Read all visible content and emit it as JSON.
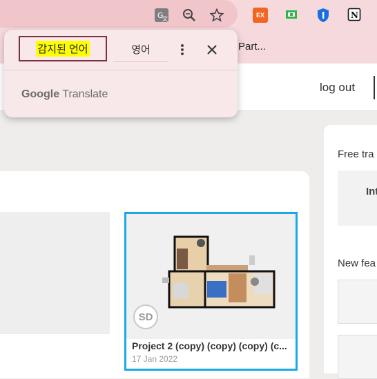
{
  "bookmarks": {
    "item_text": "Part..."
  },
  "header": {
    "logout_label": "log out"
  },
  "translate_popup": {
    "tab_detected": "감지된 언어",
    "tab_target": "영어",
    "brand_google": "Google",
    "brand_translate": "Translate"
  },
  "project": {
    "title": "Project 2 (copy) (copy) (copy) (c...",
    "date": "17 Jan 2022",
    "avatar_initials": "SD"
  },
  "sidebar": {
    "section_title": "Free tra",
    "box_label": "Int",
    "news_title": "New fea"
  },
  "extensions": {
    "ex_label": "EX"
  },
  "colors": {
    "accent": "#1aa8e6",
    "highlight": "#ffff00",
    "tab_border": "#7a2f43"
  }
}
